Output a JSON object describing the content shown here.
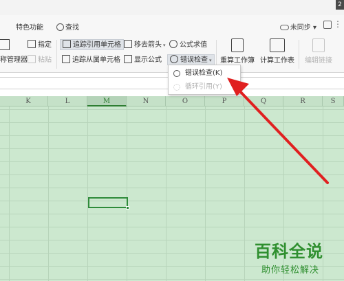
{
  "window": {
    "badge": "2"
  },
  "menu": {
    "special_features": "特色功能",
    "search": "查找",
    "sync_status": "未同步",
    "sync_caret": "▾"
  },
  "ribbon": {
    "manager": "称管理器",
    "specify": "指定",
    "paste": "粘贴",
    "trace_precedents": "追踪引用单元格",
    "trace_dependents": "追踪从属单元格",
    "remove_arrows": "移去箭头",
    "show_formulas": "显示公式",
    "evaluate_formula": "公式求值",
    "error_check": "错误检查",
    "recalc_workbook": "重算工作簿",
    "calc_sheet": "计算工作表",
    "edit_links": "编辑链接"
  },
  "dropdown": {
    "items": [
      {
        "label": "错误检查(K)",
        "enabled": true
      },
      {
        "label": "循环引用(Y)",
        "enabled": false
      }
    ]
  },
  "grid": {
    "columns": [
      "K",
      "L",
      "M",
      "N",
      "O",
      "P",
      "Q",
      "R",
      "S"
    ],
    "active_column": "M"
  },
  "watermark": {
    "title": "百科全说",
    "subtitle": "助你轻松解决"
  },
  "colors": {
    "grid_bg": "#cce8cf",
    "selection": "#2e8b3a",
    "arrow": "#e02020",
    "watermark": "#2f8f2f"
  },
  "icons": {
    "search": "search-icon",
    "cloud": "cloud-icon",
    "arrow": "red-pointer-arrow"
  }
}
